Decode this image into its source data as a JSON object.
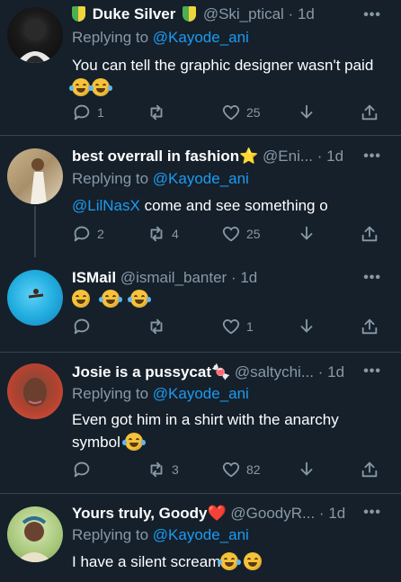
{
  "tweets": [
    {
      "name": "Duke Silver",
      "handle": "@Ski_ptical",
      "time": "1d",
      "reply_prefix": "Replying to ",
      "reply_to": "@Kayode_ani",
      "text": "You can tell the graphic designer wasn't paid",
      "emojis": [
        "rolling-on-floor-laughing",
        "rolling-on-floor-laughing"
      ],
      "replies": "1",
      "retweets": "",
      "likes": "25"
    },
    {
      "name": "best overrall in fashion",
      "name_emoji": "⭐",
      "handle": "@Eni...",
      "time": "1d",
      "reply_prefix": "Replying to ",
      "reply_to": "@Kayode_ani",
      "mention": "@LilNasX",
      "text": " come and see something o",
      "replies": "2",
      "retweets": "4",
      "likes": "25"
    },
    {
      "name": "ISMail",
      "handle": "@ismail_banter",
      "time": "1d",
      "emojis": [
        "grinning-face",
        "face-with-tears-of-joy",
        "rolling-on-floor-laughing"
      ],
      "replies": "",
      "retweets": "",
      "likes": "1"
    },
    {
      "name": "Josie is a pussycat",
      "name_emoji": "🍬",
      "handle": "@saltychi...",
      "time": "1d",
      "reply_prefix": "Replying to ",
      "reply_to": "@Kayode_ani",
      "text": "Even got him in a shirt with the anarchy symbol",
      "emojis": [
        "loudly-crying-face"
      ],
      "replies": "",
      "retweets": "3",
      "likes": "82"
    },
    {
      "name": "Yours truly, Goody",
      "name_emoji": "❤️",
      "handle": "@GoodyR...",
      "time": "1d",
      "reply_prefix": "Replying to ",
      "reply_to": "@Kayode_ani",
      "text": "I have a silent scream",
      "emojis": [
        "face-with-tears-of-joy",
        "face-with-hand-over-mouth"
      ]
    }
  ],
  "sep": " · ",
  "more_label": "•••",
  "colors": {
    "background": "#15202b",
    "divider": "#38444d",
    "secondary_text": "#8899a6",
    "link": "#1d9bf0",
    "primary_text": "#ffffff"
  }
}
